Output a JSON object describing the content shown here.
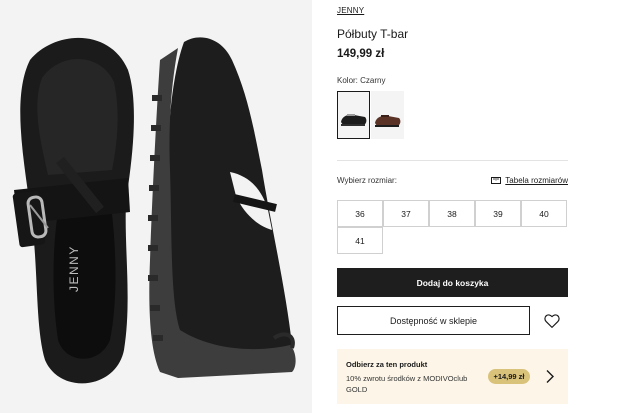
{
  "product": {
    "brand": "JENNY",
    "title": "Półbuty T-bar",
    "price": "149,99 zł",
    "image_brand_text": "JENNY"
  },
  "color": {
    "label": "Kolor: Czarny",
    "swatches": [
      {
        "name": "black",
        "selected": true,
        "shoe_color": "#1c1c1c"
      },
      {
        "name": "brown",
        "selected": false,
        "shoe_color": "#5a3226"
      }
    ]
  },
  "sizes": {
    "label": "Wybierz rozmiar:",
    "guide_label": "Tabela rozmiarów",
    "options": [
      "36",
      "37",
      "38",
      "39",
      "40",
      "41"
    ]
  },
  "actions": {
    "add_to_cart": "Dodaj do koszyka",
    "store_availability": "Dostępność w sklepie",
    "wishlist_icon": "heart-icon"
  },
  "promo": {
    "title": "Odbierz za ten produkt",
    "text": "10% zwrotu środków z MODIVOclub GOLD",
    "badge": "+14,99 zł",
    "icon": "chevron-right-icon"
  },
  "colors": {
    "primary_button": "#1e1e1e",
    "promo_background": "#fdf6e8",
    "promo_badge": "#d9c27a"
  }
}
